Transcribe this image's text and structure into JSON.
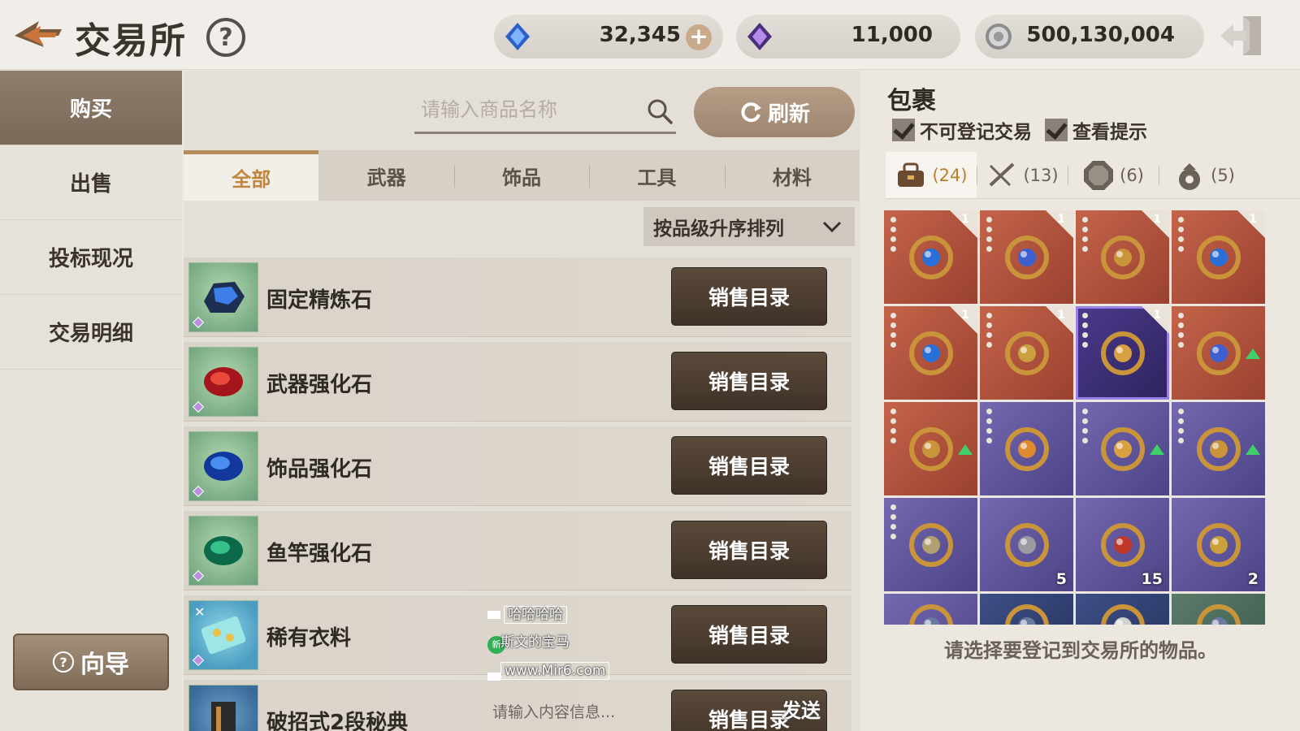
{
  "header": {
    "title": "交易所",
    "help_label": "?",
    "currencies": [
      {
        "icon": "blue-diamond-icon",
        "value": "32,345",
        "add_label": "+"
      },
      {
        "icon": "purple-diamond-icon",
        "value": "11,000"
      },
      {
        "icon": "silver-coin-icon",
        "value": "500,130,004"
      }
    ]
  },
  "sidebar": {
    "items": [
      {
        "label": "购买",
        "active": true
      },
      {
        "label": "出售"
      },
      {
        "label": "投标现况"
      },
      {
        "label": "交易明细"
      }
    ],
    "guide_label": "向导",
    "guide_q": "?"
  },
  "search": {
    "placeholder": "请输入商品名称",
    "refresh_label": "刷新"
  },
  "tabs": [
    "全部",
    "武器",
    "饰品",
    "工具",
    "材料"
  ],
  "sort": {
    "label": "按品级升序排列"
  },
  "items": [
    {
      "name": "固定精炼石",
      "button": "销售目录"
    },
    {
      "name": "武器强化石",
      "button": "销售目录"
    },
    {
      "name": "饰品强化石",
      "button": "销售目录"
    },
    {
      "name": "鱼竿强化石",
      "button": "销售目录"
    },
    {
      "name": "稀有衣料",
      "button": "销售目录"
    },
    {
      "name": "破招式2段秘典",
      "button": "销售目录"
    }
  ],
  "overlay": {
    "line1": "哈哈哈哈",
    "badge": "新",
    "line2": "斯文的宝马",
    "line3": "www.Mir6.com",
    "chat_placeholder": "请输入内容信息...",
    "send_label": "发送"
  },
  "bag": {
    "title": "包裹",
    "check1": "不可登记交易",
    "check2": "查看提示",
    "tabs": [
      {
        "icon": "bag-icon",
        "count": "(24)"
      },
      {
        "icon": "crossed-swords-icon",
        "count": "(13)"
      },
      {
        "icon": "octagon-gem-icon",
        "count": "(6)"
      },
      {
        "icon": "pouch-icon",
        "count": "(5)"
      }
    ],
    "cells": [
      {
        "color": "red",
        "count": "1",
        "icon": "necklace-icon"
      },
      {
        "color": "red",
        "count": "1",
        "icon": "butterfly-necklace-icon"
      },
      {
        "color": "red",
        "count": "1",
        "icon": "ring-icon"
      },
      {
        "color": "red",
        "count": "1",
        "icon": "bracelet-icon"
      },
      {
        "color": "red",
        "count": "1",
        "icon": "bracelet-icon"
      },
      {
        "color": "red",
        "count": "1",
        "icon": "bangle-icon"
      },
      {
        "color": "purple-sel",
        "count": "1",
        "icon": "weapon-icon"
      },
      {
        "color": "red",
        "count": "",
        "icon": "butterfly-necklace-icon",
        "up": true
      },
      {
        "color": "red",
        "count": "",
        "icon": "ring-icon",
        "up": true
      },
      {
        "color": "purple",
        "count": "",
        "icon": "pendant-icon"
      },
      {
        "color": "purple",
        "count": "",
        "icon": "earring-icon",
        "up": true
      },
      {
        "color": "purple",
        "count": "",
        "icon": "ring-icon",
        "up": true
      },
      {
        "color": "purple",
        "count": "",
        "icon": "bead-bracelet-icon"
      },
      {
        "color": "purple",
        "stack": "5",
        "icon": "chest-icon"
      },
      {
        "color": "purple",
        "stack": "15",
        "icon": "red-talisman-icon"
      },
      {
        "color": "purple",
        "stack": "2",
        "icon": "gold-talisman-icon"
      },
      {
        "color": "purple",
        "icon": "item-icon"
      },
      {
        "color": "navy",
        "icon": "item-icon"
      },
      {
        "color": "navy",
        "icon": "tool-icon"
      },
      {
        "color": "teal",
        "icon": "item-icon"
      }
    ],
    "hint": "请选择要登记到交易所的物品。"
  }
}
